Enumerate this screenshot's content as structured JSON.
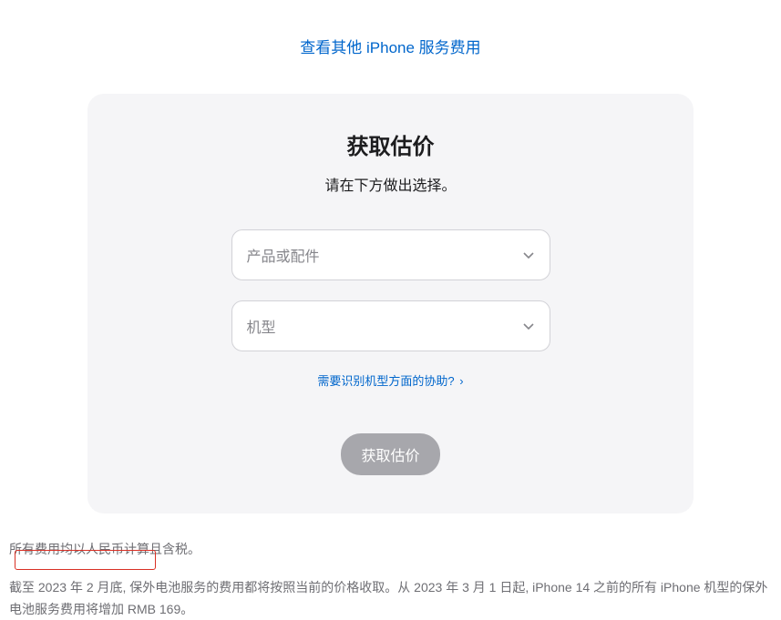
{
  "topLink": {
    "label": "查看其他 iPhone 服务费用"
  },
  "card": {
    "title": "获取估价",
    "subtitle": "请在下方做出选择。",
    "select1": {
      "placeholder": "产品或配件"
    },
    "select2": {
      "placeholder": "机型"
    },
    "helpLink": {
      "label": "需要识别机型方面的协助?",
      "chevron": "›"
    },
    "submitButton": {
      "label": "获取估价"
    }
  },
  "footer": {
    "p1": "所有费用均以人民币计算且含税。",
    "p2": "截至 2023 年 2 月底, 保外电池服务的费用都将按照当前的价格收取。从 2023 年 3 月 1 日起, iPhone 14 之前的所有 iPhone 机型的保外电池服务费用将增加 RMB 169。"
  }
}
